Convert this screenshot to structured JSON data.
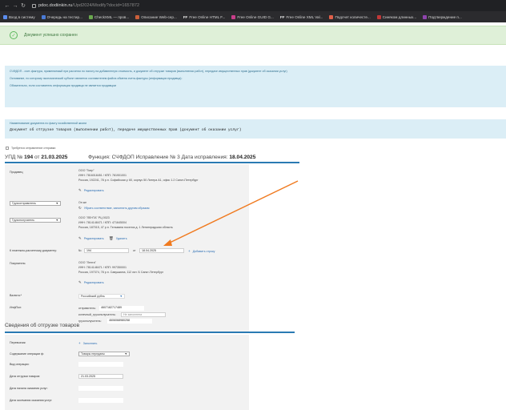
{
  "browser": {
    "url_domain": "pdoc.dodiinkin.ru",
    "url_path": "/Upd2024/Modify?docid=1657872",
    "bookmarks": [
      {
        "label": "Вход в систему",
        "color": "#5b8def"
      },
      {
        "label": "Очередь на тестир...",
        "color": "#4a7bd6"
      },
      {
        "label": "CheckXML — пров...",
        "color": "#6aa84f"
      },
      {
        "label": "Описание Web-сер...",
        "color": "#cc5f3a"
      },
      {
        "label": "Free Online HTML F...",
        "ff": "FF"
      },
      {
        "label": "Free Online GUID G...",
        "color": "#c93e8a"
      },
      {
        "label": "Free Online XML Val...",
        "ff": "FF"
      },
      {
        "label": "Подсчет количесте...",
        "color": "#e0604a"
      },
      {
        "label": "Синяком длинных...",
        "color": "#c13838"
      },
      {
        "label": "Подтверждение п...",
        "color": "#8e44ad"
      }
    ]
  },
  "alert": {
    "text": "Документ успешно сохранен"
  },
  "info": {
    "line1": "СЧФДОП - счет-фактура, применяемый при расчетах по налогу на добавленную стоимость, и документ об отгрузке товаров (выполнении работ), передаче имущественных прав (документ об оказании услуг)",
    "line2": "Основание, по которому экономический субъект является составителем файла обмена счета-фактуры (информации продавца):",
    "line3": "Обязательно, если составитель информации продавца не является продавцом"
  },
  "docname": {
    "label": "Наименование документа по факту хозяйственной жизни",
    "value": "Документ об отгрузке товаров (выполнении работ), передаче имущественных прав (документ об оказании услуг)"
  },
  "flag_label": "Требуется отправление отправки",
  "header": {
    "upd_prefix": "УПД №",
    "upd_number": "194",
    "from": "от",
    "date": "21.03.2025",
    "function_label": "Функция: СЧФДОП",
    "correction_label": "Исправление № 3",
    "correction_date_label": "Дата исправления:",
    "correction_date": "18.04.2025"
  },
  "seller": {
    "label": "Продавец",
    "name": "ООО \"Гиер\"",
    "inn": "ИНН: 7816018451 / КПП: 781901001",
    "address": "Россия, 192241, 78 р.н. Софийская у. 60, корпус 50 Литера А1, офис 1.2 Санкт-Петербург",
    "edit": "Редактировать"
  },
  "shipper": {
    "select": "Грузоотправитель",
    "same": "Он же",
    "action": "Убрать соответствие, заполнить другим образом"
  },
  "consignee": {
    "select": "Грузополучатель",
    "name": "ООО \"ЛЕНТА\" РЦ 0023",
    "inn": "ИНН: 7814148471 / КПП: 471645004",
    "address": "Россия, 187015, 47 р.н. Тельмана поселок д. 1 Ленинградская область",
    "edit": "Редактировать",
    "delete": "Удалить"
  },
  "payment_doc": {
    "label": "К платежно-расчетному документу:",
    "no_label": "№",
    "no_value": "194",
    "from_label": "от",
    "from_value": "18.04.2025",
    "add": "Добавить строку"
  },
  "buyer": {
    "label": "Покупатель:",
    "name": "ООО \"Лента\"",
    "inn": "ИНН: 7814148471 / КПП: 997350001",
    "address": "Россия, 197374, 78 р.н. Савушкина, 112 лит. Б Санкт-Петербург",
    "edit": "Редактировать"
  },
  "currency": {
    "label": "Валюта:*",
    "value": "Российский рубль"
  },
  "infpol": {
    "label": "ИнфПол:",
    "rows": [
      {
        "key": "отправитель:",
        "value": "4607182717489"
      },
      {
        "key": "конечный_грузополучатель:",
        "value": "Не заполнена",
        "muted": true
      },
      {
        "key": "грузополучатель:",
        "value": "4606068980258"
      }
    ]
  },
  "shipment_section": {
    "title": "Сведения об отгрузке товаров"
  },
  "shipment": {
    "transfer_label": "Перевозчик:",
    "transfer_action": "Заполнить",
    "content_label": "Содержание операции ф:",
    "content_value": "Товары переданы",
    "type_label": "Вид операции:",
    "ship_date_label": "Дата отгрузки товаров:",
    "ship_date_value": "21.03.2025",
    "service_start_label": "Дата начала оказания услуг:",
    "service_end_label": "Дата окончания оказания услуг:"
  },
  "colors": {
    "accent": "#2a7ab3",
    "success_bg": "#dff0d8",
    "info_bg": "#dbeef6",
    "arrow": "#f07a1f"
  }
}
